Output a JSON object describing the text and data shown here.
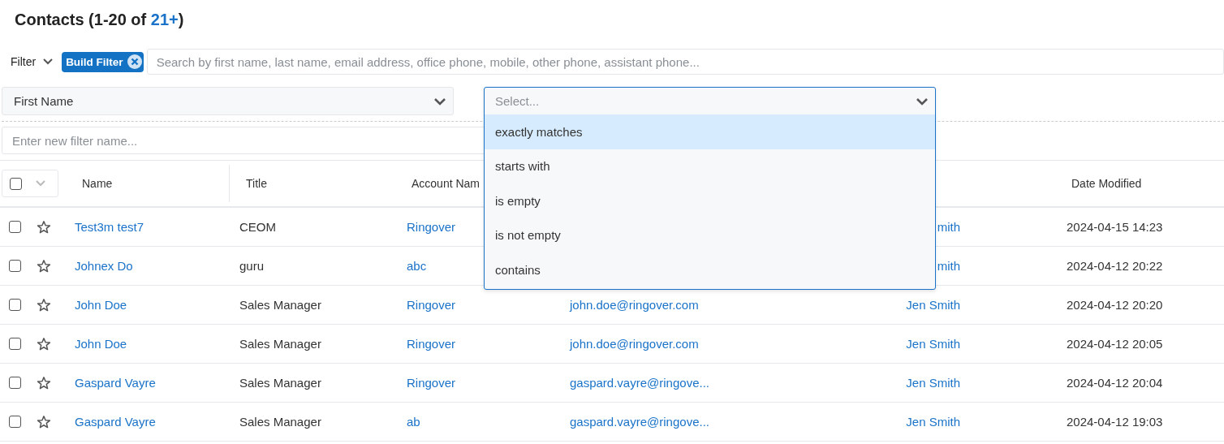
{
  "title": {
    "text": "Contacts (1-20 of ",
    "count": "21+",
    "close": ")"
  },
  "filter": {
    "label": "Filter",
    "chip": "Build Filter",
    "search_placeholder": "Search by first name, last name, email address, office phone, mobile, other phone, assistant phone..."
  },
  "field_select": {
    "value": "First Name"
  },
  "operator_select": {
    "placeholder": "Select...",
    "expanded": true,
    "options": [
      {
        "label": "exactly matches",
        "selected": true
      },
      {
        "label": "starts with",
        "selected": false
      },
      {
        "label": "is empty",
        "selected": false
      },
      {
        "label": "is not empty",
        "selected": false
      },
      {
        "label": "contains",
        "selected": false
      }
    ]
  },
  "filter_name": {
    "placeholder": "Enter new filter name..."
  },
  "table": {
    "select_all_checked": false,
    "header": {
      "name": "Name",
      "title": "Title",
      "account": "Account Nam",
      "date": "Date Modified"
    },
    "rows": [
      {
        "checked": false,
        "starred": false,
        "name": "Test3m test7",
        "title": "CEOM",
        "account": "Ringover",
        "user": "mith",
        "date": "2024-04-15 14:23"
      },
      {
        "checked": false,
        "starred": false,
        "name": "Johnex Do",
        "title": "guru",
        "account": "abc",
        "user": "mith",
        "date": "2024-04-12 20:22"
      },
      {
        "checked": false,
        "starred": false,
        "name": "John Doe",
        "title": "Sales Manager",
        "account": "Ringover",
        "email": "john.doe@ringover.com",
        "user": "Jen Smith",
        "date": "2024-04-12 20:20"
      },
      {
        "checked": false,
        "starred": false,
        "name": "John Doe",
        "title": "Sales Manager",
        "account": "Ringover",
        "email": "john.doe@ringover.com",
        "user": "Jen Smith",
        "date": "2024-04-12 20:05"
      },
      {
        "checked": false,
        "starred": false,
        "name": "Gaspard Vayre",
        "title": "Sales Manager",
        "account": "Ringover",
        "email": "gaspard.vayre@ringove...",
        "user": "Jen Smith",
        "date": "2024-04-12 20:04"
      },
      {
        "checked": false,
        "starred": false,
        "name": "Gaspard Vayre",
        "title": "Sales Manager",
        "account": "ab",
        "email": "gaspard.vayre@ringove...",
        "user": "Jen Smith",
        "date": "2024-04-12 19:03"
      }
    ]
  }
}
